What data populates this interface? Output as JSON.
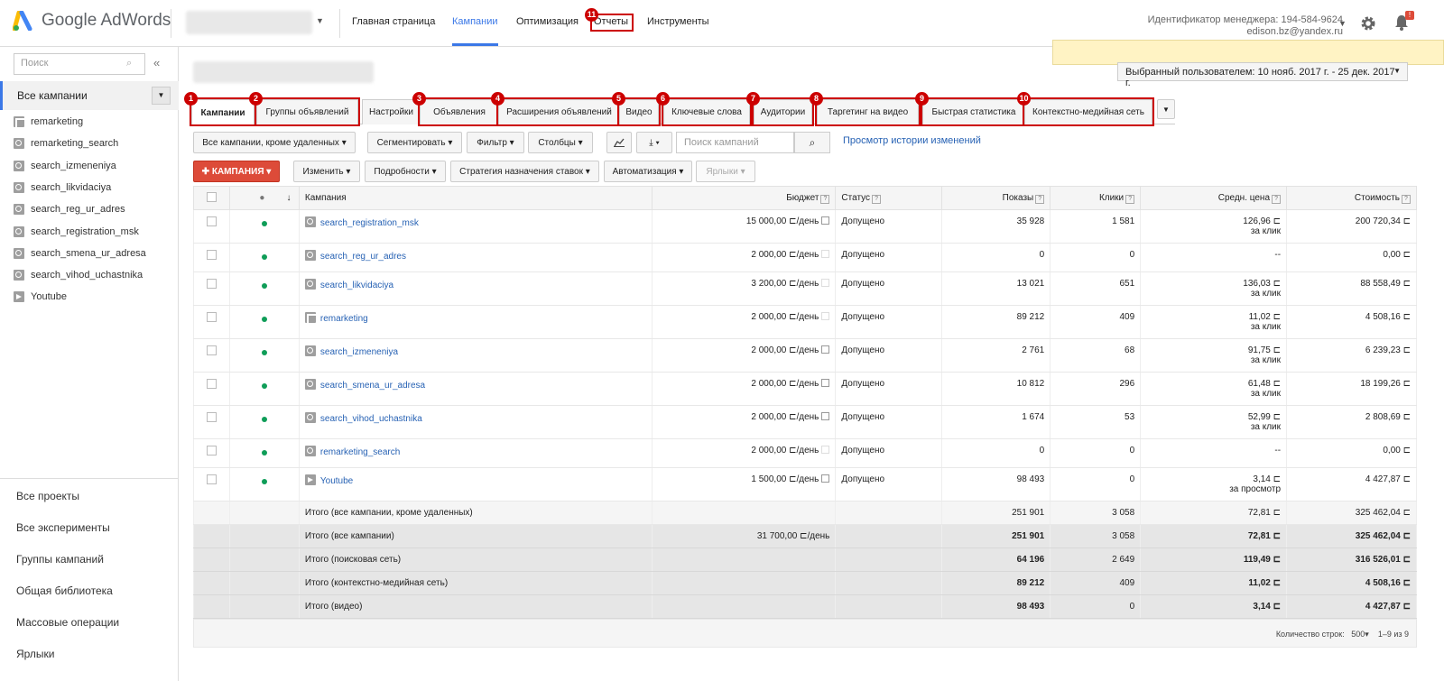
{
  "app": {
    "logo_text": "Google AdWords"
  },
  "nav": {
    "items": [
      "Главная страница",
      "Кампании",
      "Оптимизация",
      "Отчеты",
      "Инструменты"
    ],
    "active": "Кампании",
    "reports_badge": "11"
  },
  "header": {
    "manager_id": "Идентификатор менеджера: 194-584-9624",
    "email": "edison.bz@yandex.ru",
    "bell_badge": "!"
  },
  "sidebar": {
    "search_placeholder": "Поиск",
    "all_campaigns": "Все кампании",
    "campaigns": [
      {
        "name": "remarketing",
        "icon": "display-icon"
      },
      {
        "name": "remarketing_search",
        "icon": "search-icon"
      },
      {
        "name": "search_izmeneniya",
        "icon": "search-icon"
      },
      {
        "name": "search_likvidaciya",
        "icon": "search-icon"
      },
      {
        "name": "search_reg_ur_adres",
        "icon": "search-icon"
      },
      {
        "name": "search_registration_msk",
        "icon": "search-icon"
      },
      {
        "name": "search_smena_ur_adresa",
        "icon": "search-icon"
      },
      {
        "name": "search_vihod_uchastnika",
        "icon": "search-icon"
      },
      {
        "name": "Youtube",
        "icon": "video-icon"
      }
    ],
    "bottom_links": [
      "Все проекты",
      "Все эксперименты",
      "Группы кампаний",
      "Общая библиотека",
      "Массовые операции",
      "Ярлыки"
    ]
  },
  "date_range": "Выбранный пользователем: 10 нояб. 2017 г. - 25 дек. 2017 г.",
  "tabs": [
    {
      "label": "Кампании",
      "badge": "1"
    },
    {
      "label": "Группы объявлений",
      "badge": "2"
    },
    {
      "label": "Настройки",
      "badge": ""
    },
    {
      "label": "Объявления",
      "badge": "3"
    },
    {
      "label": "Расширения объявлений",
      "badge": "4"
    },
    {
      "label": "Видео",
      "badge": "5"
    },
    {
      "label": "Ключевые слова",
      "badge": "6"
    },
    {
      "label": "Аудитории",
      "badge": "7"
    },
    {
      "label": "Таргетинг на видео",
      "badge": "8"
    },
    {
      "label": "Быстрая статистика",
      "badge": "9"
    },
    {
      "label": "Контекстно-медийная сеть",
      "badge": "10"
    }
  ],
  "toolbar": {
    "filter_all": "Все кампании, кроме удаленных",
    "segment": "Сегментировать",
    "filter": "Фильтр",
    "columns": "Столбцы",
    "search_placeholder": "Поиск кампаний",
    "history": "Просмотр истории изменений",
    "campaign_btn": "КАМПАНИЯ",
    "edit": "Изменить",
    "details": "Подробности",
    "bid_strategy": "Стратегия назначения ставок",
    "automation": "Автоматизация",
    "labels": "Ярлыки"
  },
  "table": {
    "headers": {
      "campaign": "Кампания",
      "budget": "Бюджет",
      "status": "Статус",
      "impressions": "Показы",
      "clicks": "Клики",
      "avg_cost": "Средн. цена",
      "cost": "Стоимость"
    },
    "rows": [
      {
        "name": "search_registration_msk",
        "type": "search",
        "budget": "15 000,00 ⊏/день",
        "status": "Допущено",
        "impr": "35 928",
        "clicks": "1 581",
        "avg": "126,96 ⊏",
        "avg_sub": "за клик",
        "cost": "200 720,34 ⊏"
      },
      {
        "name": "search_reg_ur_adres",
        "type": "search",
        "budget": "2 000,00 ⊏/день",
        "status": "Допущено",
        "impr": "0",
        "clicks": "0",
        "avg": "--",
        "avg_sub": "",
        "cost": "0,00 ⊏"
      },
      {
        "name": "search_likvidaciya",
        "type": "search",
        "budget": "3 200,00 ⊏/день",
        "status": "Допущено",
        "impr": "13 021",
        "clicks": "651",
        "avg": "136,03 ⊏",
        "avg_sub": "за клик",
        "cost": "88 558,49 ⊏"
      },
      {
        "name": "remarketing",
        "type": "display",
        "budget": "2 000,00 ⊏/день",
        "status": "Допущено",
        "impr": "89 212",
        "clicks": "409",
        "avg": "11,02 ⊏",
        "avg_sub": "за клик",
        "cost": "4 508,16 ⊏"
      },
      {
        "name": "search_izmeneniya",
        "type": "search",
        "budget": "2 000,00 ⊏/день",
        "status": "Допущено",
        "impr": "2 761",
        "clicks": "68",
        "avg": "91,75 ⊏",
        "avg_sub": "за клик",
        "cost": "6 239,23 ⊏"
      },
      {
        "name": "search_smena_ur_adresa",
        "type": "search",
        "budget": "2 000,00 ⊏/день",
        "status": "Допущено",
        "impr": "10 812",
        "clicks": "296",
        "avg": "61,48 ⊏",
        "avg_sub": "за клик",
        "cost": "18 199,26 ⊏"
      },
      {
        "name": "search_vihod_uchastnika",
        "type": "search",
        "budget": "2 000,00 ⊏/день",
        "status": "Допущено",
        "impr": "1 674",
        "clicks": "53",
        "avg": "52,99 ⊏",
        "avg_sub": "за клик",
        "cost": "2 808,69 ⊏"
      },
      {
        "name": "remarketing_search",
        "type": "search",
        "budget": "2 000,00 ⊏/день",
        "status": "Допущено",
        "impr": "0",
        "clicks": "0",
        "avg": "--",
        "avg_sub": "",
        "cost": "0,00 ⊏"
      },
      {
        "name": "Youtube",
        "type": "video",
        "budget": "1 500,00 ⊏/день",
        "status": "Допущено",
        "impr": "98 493",
        "clicks": "0",
        "avg": "3,14 ⊏",
        "avg_sub": "за просмотр",
        "cost": "4 427,87 ⊏"
      }
    ],
    "totals": [
      {
        "label": "Итого (все кампании, кроме удаленных)",
        "budget": "",
        "impr": "251 901",
        "clicks": "3 058",
        "avg": "72,81 ⊏",
        "cost": "325 462,04 ⊏"
      },
      {
        "label": "Итого (все кампании)",
        "budget": "31 700,00 ⊏/день",
        "impr": "251 901",
        "clicks": "3 058",
        "avg": "72,81 ⊏",
        "cost": "325 462,04 ⊏"
      },
      {
        "label": "Итого (поисковая сеть)",
        "budget": "",
        "impr": "64 196",
        "clicks": "2 649",
        "avg": "119,49 ⊏",
        "cost": "316 526,01 ⊏"
      },
      {
        "label": "Итого (контекстно-медийная сеть)",
        "budget": "",
        "impr": "89 212",
        "clicks": "409",
        "avg": "11,02 ⊏",
        "cost": "4 508,16 ⊏"
      },
      {
        "label": "Итого (видео)",
        "budget": "",
        "impr": "98 493",
        "clicks": "0",
        "avg": "3,14 ⊏",
        "cost": "4 427,87 ⊏"
      }
    ]
  },
  "footer": {
    "rows_label": "Количество строк:",
    "rows_value": "500",
    "range": "1–9 из 9"
  },
  "colors": {
    "accent": "#3b78e7",
    "red": "#dd4b39",
    "annotation": "#cc0000",
    "status_dot": "#0f9d58"
  }
}
